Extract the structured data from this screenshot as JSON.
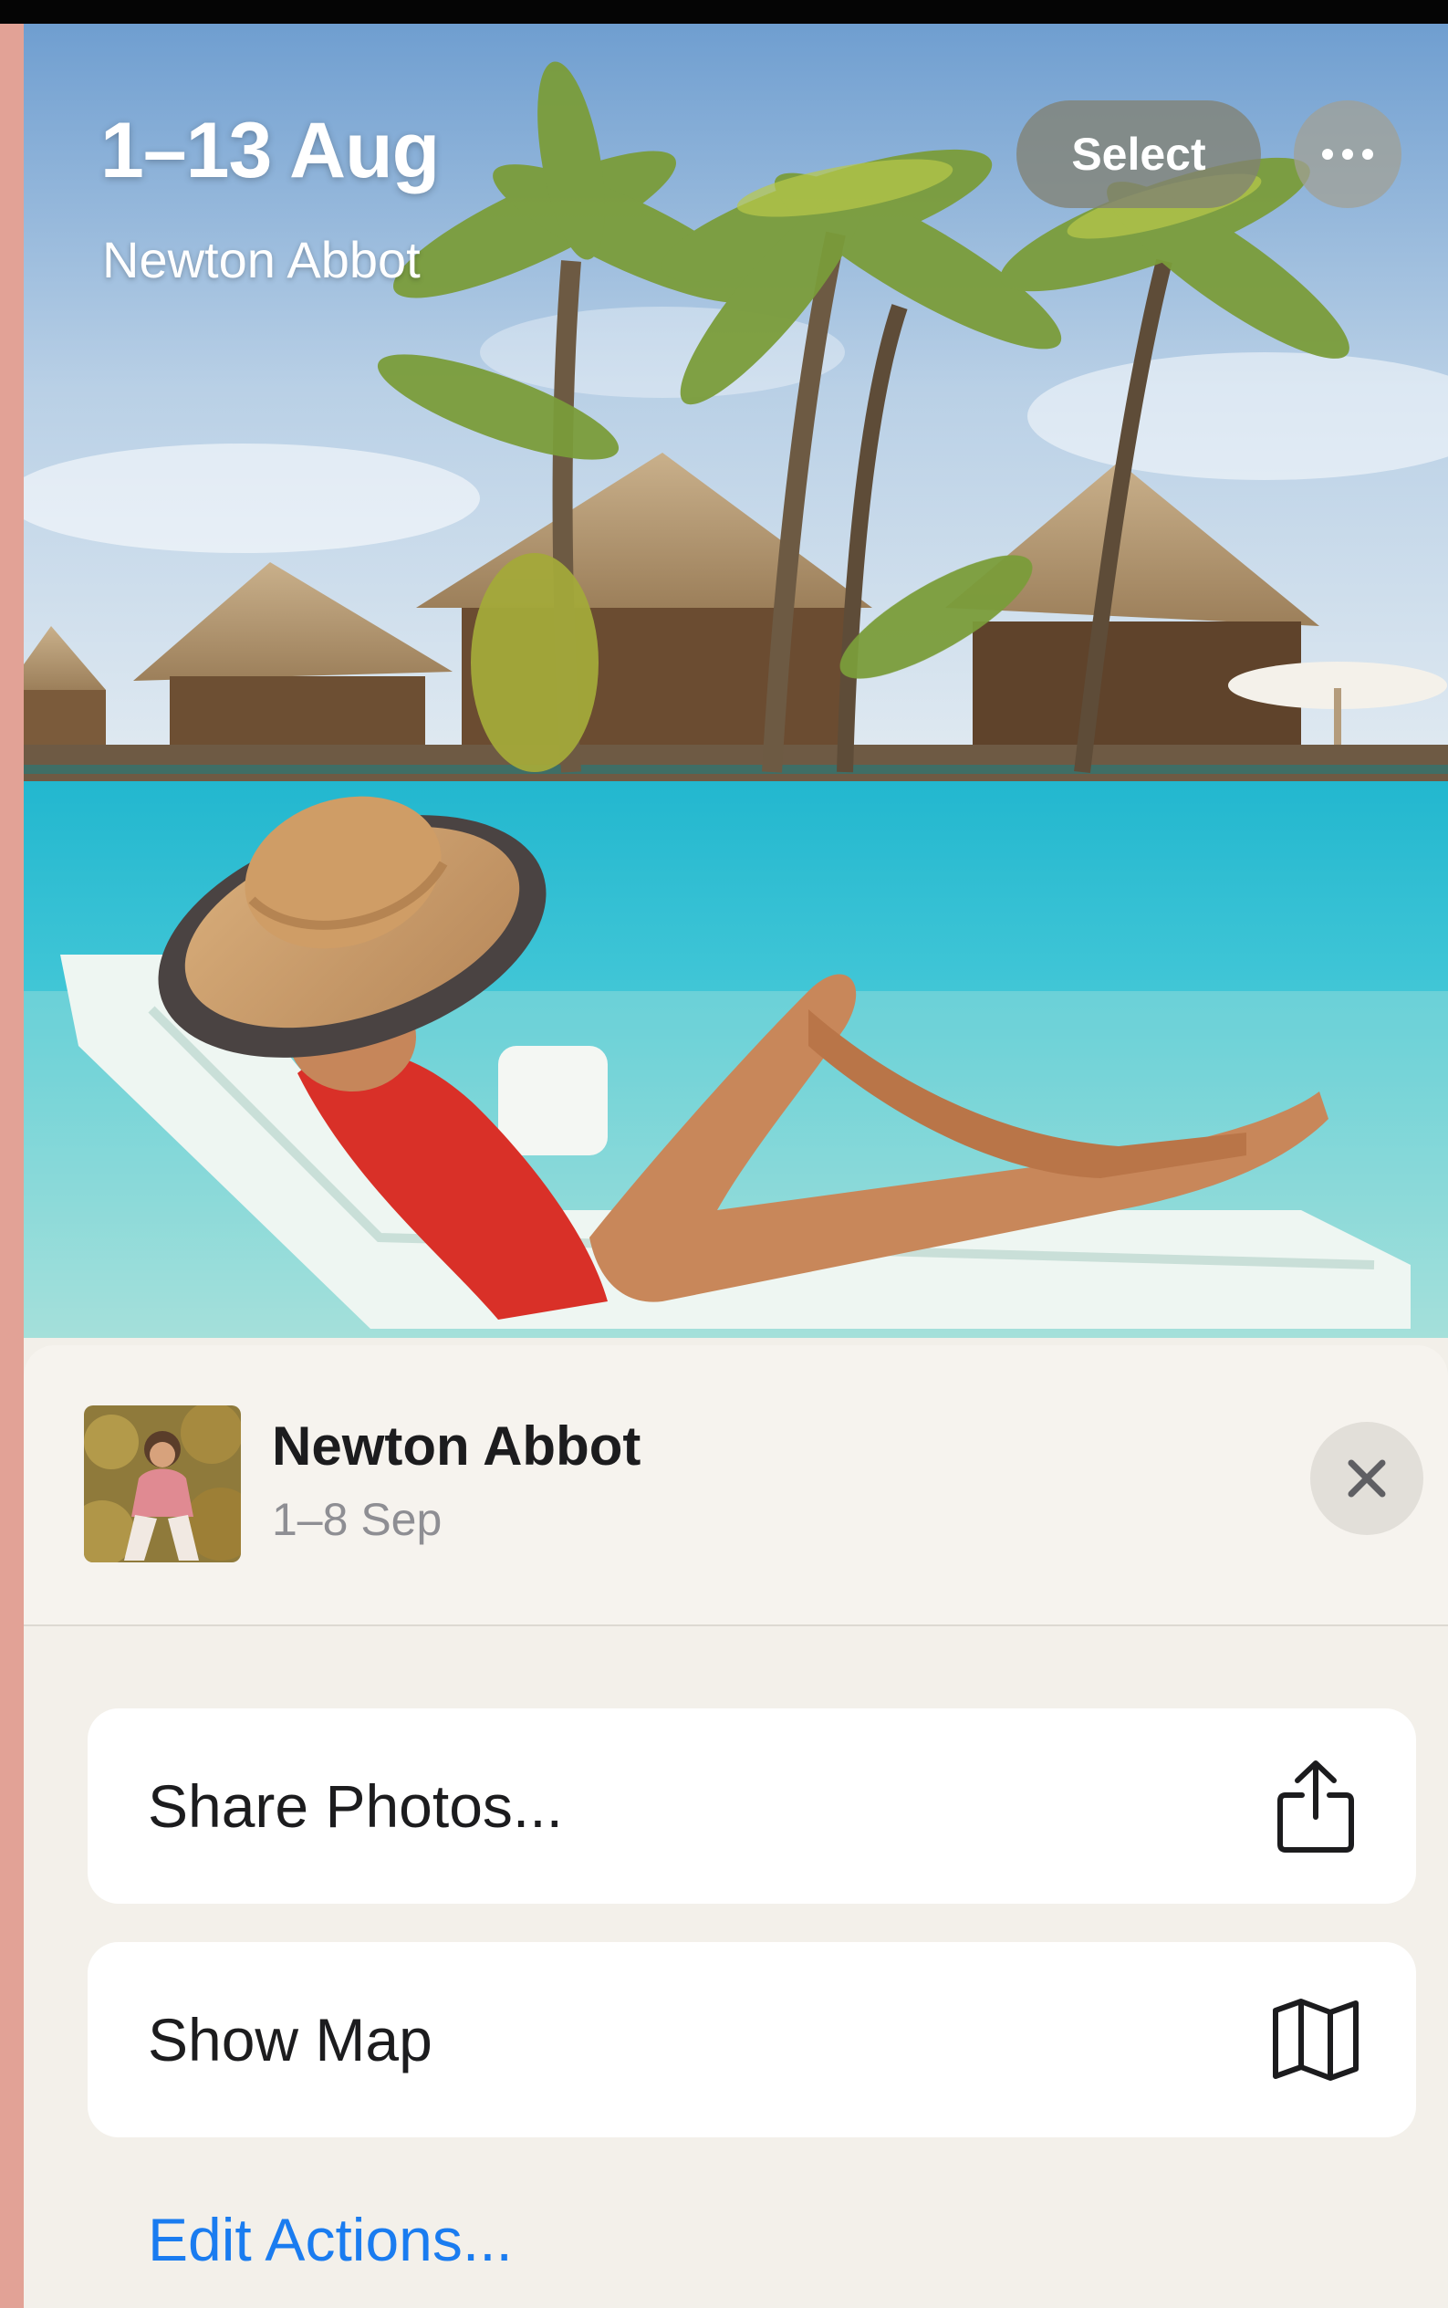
{
  "header": {
    "title": "1–13 Aug",
    "subtitle": "Newton Abbot",
    "select_label": "Select"
  },
  "sheet": {
    "title": "Newton Abbot",
    "date": "1–8 Sep",
    "actions": [
      {
        "label": "Share Photos...",
        "icon": "share-icon"
      },
      {
        "label": "Show Map",
        "icon": "map-icon"
      }
    ],
    "edit_actions_label": "Edit Actions..."
  },
  "colors": {
    "accent": "#1a7cf0",
    "sheet_background": "#f3f0ea",
    "card_background": "#ffffff",
    "edge": "#e2a296"
  }
}
